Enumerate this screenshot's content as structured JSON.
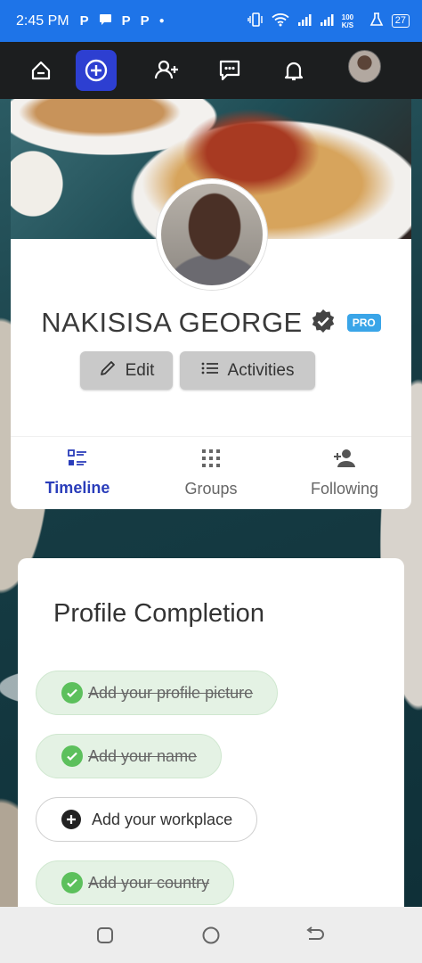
{
  "status_bar": {
    "time": "2:45 PM",
    "notification_letters": [
      "P",
      "P",
      "P"
    ],
    "data_speed": "100 K/S",
    "battery": "27"
  },
  "nav": {
    "items": [
      "home-icon",
      "add-circle-icon",
      "add-friend-icon",
      "messages-icon",
      "bell-icon"
    ],
    "active": "add-circle-icon"
  },
  "profile": {
    "name": "NAKISISA GEORGE",
    "badge": "PRO",
    "edit_label": "Edit",
    "activities_label": "Activities",
    "tabs": [
      {
        "label": "Timeline",
        "icon": "timeline-icon",
        "active": true
      },
      {
        "label": "Groups",
        "icon": "groups-icon",
        "active": false
      },
      {
        "label": "Following",
        "icon": "following-icon",
        "active": false
      }
    ]
  },
  "completion": {
    "title": "Profile Completion",
    "steps": [
      {
        "label": "Add your profile picture",
        "done": true
      },
      {
        "label": "Add your name",
        "done": true
      },
      {
        "label": "Add your workplace",
        "done": false
      },
      {
        "label": "Add your country",
        "done": true
      }
    ]
  },
  "colors": {
    "status_bar": "#1e74e8",
    "nav_bg": "#1c1e1f",
    "active_nav": "#2d3fd1",
    "active_tab": "#2a3dba",
    "pro_badge": "#3aa5e8",
    "done_step": "#e4f2e4",
    "check": "#5cc05c"
  }
}
